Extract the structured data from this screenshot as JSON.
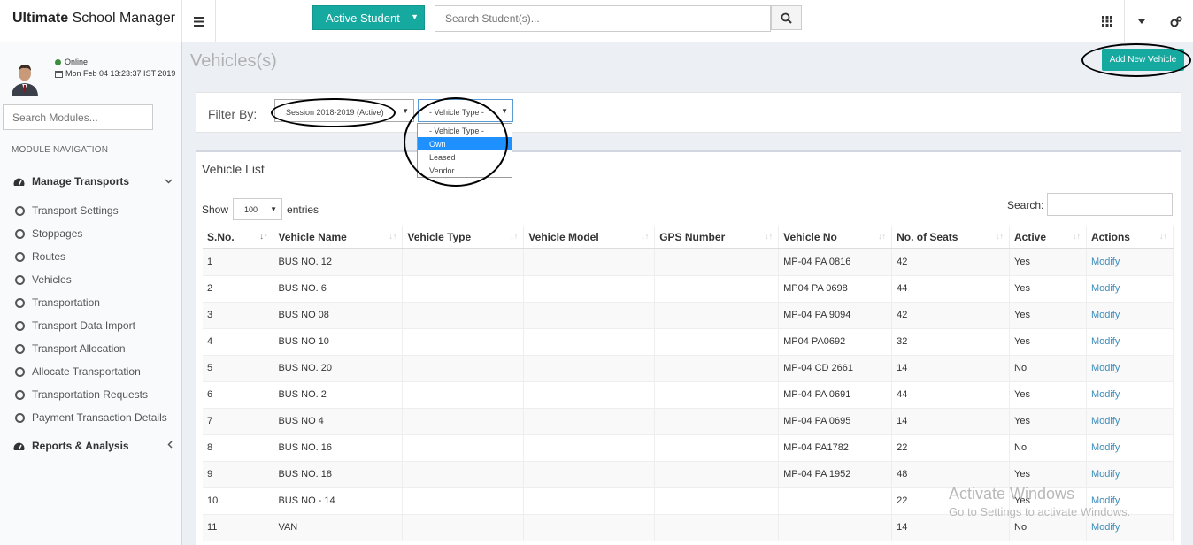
{
  "header": {
    "brand_bold": "Ultimate",
    "brand_rest": " School Manager",
    "active_student": "Active Student",
    "search_placeholder": "Search Student(s)..."
  },
  "sidebar": {
    "status": "Online",
    "datetime": "Mon Feb 04 13:23:37 IST 2019",
    "search_placeholder": "Search Modules...",
    "nav_title": "MODULE NAVIGATION",
    "manage_transports": "Manage Transports",
    "items": [
      "Transport Settings",
      "Stoppages",
      "Routes",
      "Vehicles",
      "Transportation",
      "Transport Data Import",
      "Transport Allocation",
      "Allocate Transportation",
      "Transportation Requests",
      "Payment Transaction Details"
    ],
    "reports": "Reports & Analysis"
  },
  "page": {
    "title": "Vehicles(s)",
    "add_button": "Add New Vehicle"
  },
  "filter": {
    "label": "Filter By:",
    "session": "Session 2018-2019 (Active)",
    "vehicle_type": "- Vehicle Type -",
    "options": [
      "- Vehicle Type -",
      "Own",
      "Leased",
      "Vendor"
    ]
  },
  "list": {
    "title": "Vehicle List",
    "show": "Show",
    "entries_value": "100",
    "entries": "entries",
    "search_label": "Search:",
    "columns": [
      "S.No.",
      "Vehicle Name",
      "Vehicle Type",
      "Vehicle Model",
      "GPS Number",
      "Vehicle No",
      "No. of Seats",
      "Active",
      "Actions"
    ],
    "rows": [
      [
        "1",
        "BUS NO. 12",
        "",
        "",
        "",
        "MP-04 PA 0816",
        "42",
        "Yes",
        "Modify"
      ],
      [
        "2",
        "BUS NO. 6",
        "",
        "",
        "",
        "MP04 PA 0698",
        "44",
        "Yes",
        "Modify"
      ],
      [
        "3",
        "BUS NO 08",
        "",
        "",
        "",
        "MP-04 PA 9094",
        "42",
        "Yes",
        "Modify"
      ],
      [
        "4",
        "BUS NO 10",
        "",
        "",
        "",
        "MP04 PA0692",
        "32",
        "Yes",
        "Modify"
      ],
      [
        "5",
        "BUS NO. 20",
        "",
        "",
        "",
        "MP-04 CD 2661",
        "14",
        "No",
        "Modify"
      ],
      [
        "6",
        "BUS NO. 2",
        "",
        "",
        "",
        "MP-04 PA 0691",
        "44",
        "Yes",
        "Modify"
      ],
      [
        "7",
        "BUS NO 4",
        "",
        "",
        "",
        "MP-04 PA 0695",
        "14",
        "Yes",
        "Modify"
      ],
      [
        "8",
        "BUS NO. 16",
        "",
        "",
        "",
        "MP-04 PA1782",
        "22",
        "No",
        "Modify"
      ],
      [
        "9",
        "BUS NO. 18",
        "",
        "",
        "",
        "MP-04 PA 1952",
        "48",
        "Yes",
        "Modify"
      ],
      [
        "10",
        "BUS NO - 14",
        "",
        "",
        "",
        "",
        "22",
        "Yes",
        "Modify"
      ],
      [
        "11",
        "VAN",
        "",
        "",
        "",
        "",
        "14",
        "No",
        "Modify"
      ]
    ]
  },
  "watermark": {
    "line1": "Activate Windows",
    "line2": "Go to Settings to activate Windows."
  }
}
